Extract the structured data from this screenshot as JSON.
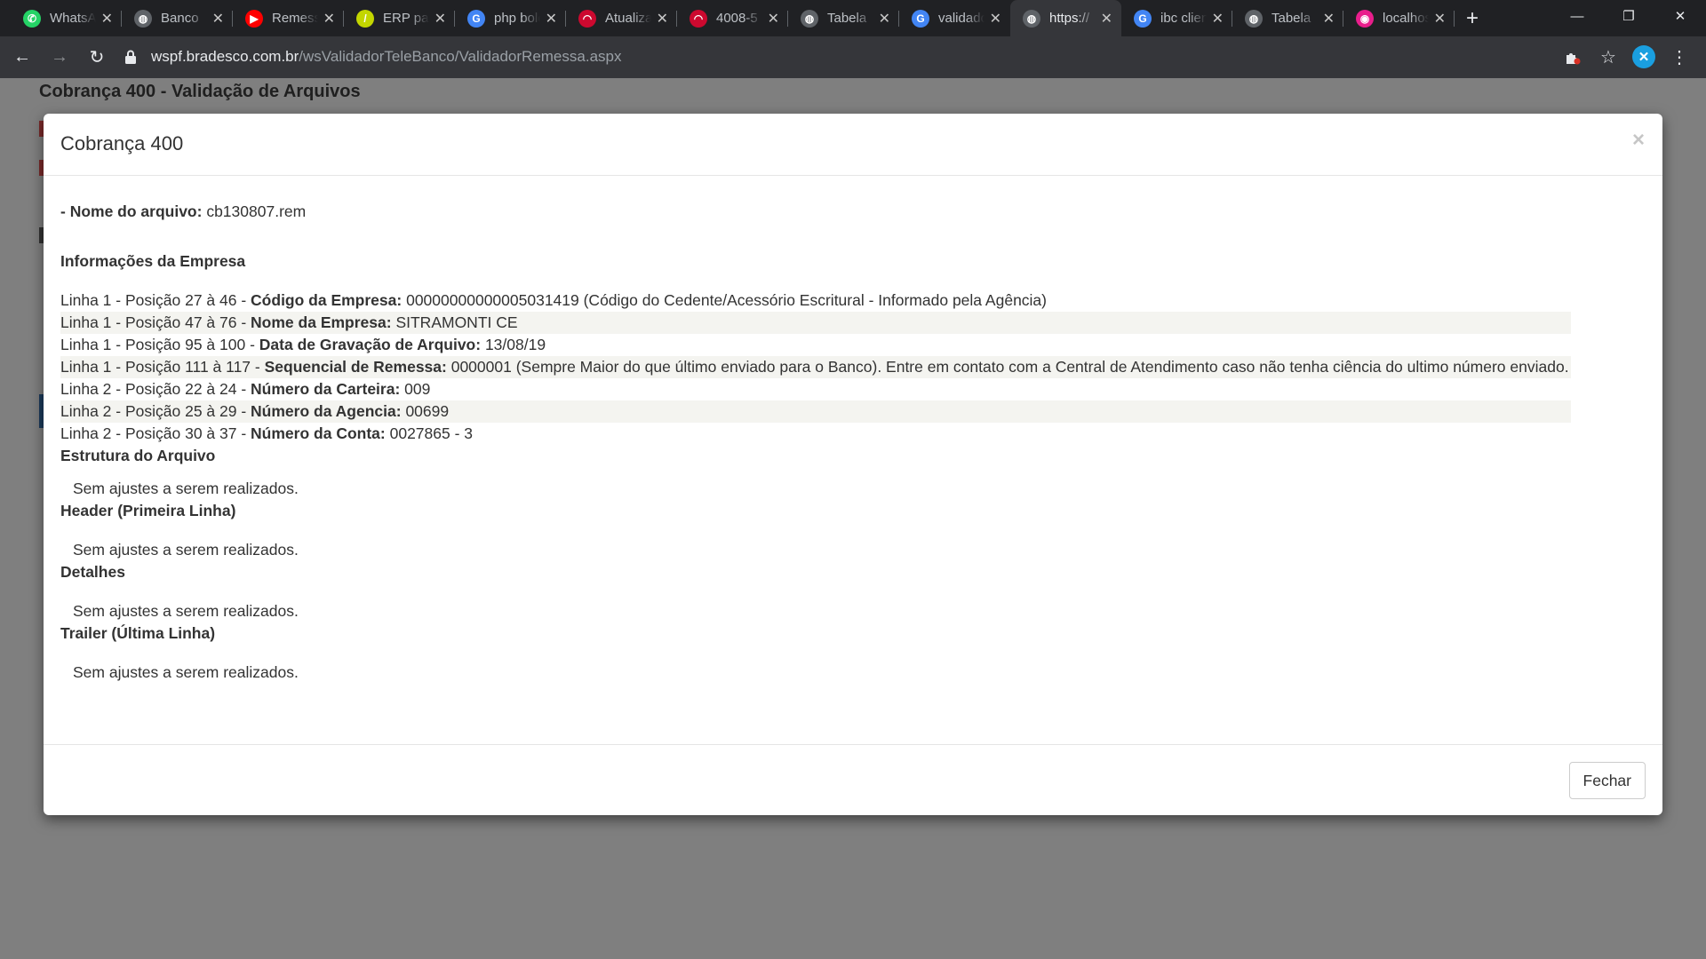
{
  "browser": {
    "tabs": [
      {
        "title": "WhatsApp",
        "icon": "whatsapp-icon",
        "color": "#25d366",
        "glyph": "✆"
      },
      {
        "title": "Banco",
        "icon": "globe-icon",
        "color": "#5f6368",
        "glyph": "◍"
      },
      {
        "title": "Remessa",
        "icon": "youtube-icon",
        "color": "#ff0000",
        "glyph": "▶"
      },
      {
        "title": "ERP para",
        "icon": "erp-icon",
        "color": "#c3d600",
        "glyph": "/"
      },
      {
        "title": "php boleto",
        "icon": "google-icon",
        "color": "#4285f4",
        "glyph": "G"
      },
      {
        "title": "Atualizar",
        "icon": "bradesco-icon",
        "color": "#cc092f",
        "glyph": "◠"
      },
      {
        "title": "4008-5",
        "icon": "bradesco-icon",
        "color": "#cc092f",
        "glyph": "◠"
      },
      {
        "title": "Tabela",
        "icon": "globe-icon",
        "color": "#5f6368",
        "glyph": "◍"
      },
      {
        "title": "validador",
        "icon": "google-icon",
        "color": "#4285f4",
        "glyph": "G"
      },
      {
        "title": "https://",
        "icon": "globe-icon",
        "color": "#5f6368",
        "glyph": "◍",
        "active": true
      },
      {
        "title": "ibc cliente",
        "icon": "google-icon",
        "color": "#4285f4",
        "glyph": "G"
      },
      {
        "title": "Tabela",
        "icon": "globe-icon",
        "color": "#5f6368",
        "glyph": "◍"
      },
      {
        "title": "localhost",
        "icon": "localhost-icon",
        "color": "#e91e8c",
        "glyph": "◉"
      }
    ],
    "new_tab": "+",
    "url_host": "wspf.bradesco.com.br",
    "url_path": "/wsValidadorTeleBanco/ValidadorRemessa.aspx"
  },
  "page": {
    "title": "Cobrança 400 - Validação de Arquivos"
  },
  "modal": {
    "title": "Cobrança 400",
    "close_glyph": "×",
    "file_label": "- Nome do arquivo:",
    "file_name": "cb130807.rem",
    "company_section": "Informações da Empresa",
    "rows": [
      {
        "prefix": "Linha 1 - Posição 27 à 46 -",
        "label": "Código da Empresa:",
        "value": "00000000000005031419 (Código do Cedente/Acessório Escritural - Informado pela Agência)"
      },
      {
        "prefix": "Linha 1 - Posição 47 à 76 -",
        "label": "Nome da Empresa:",
        "value": "SITRAMONTI CE"
      },
      {
        "prefix": "Linha 1 - Posição 95 à 100 -",
        "label": "Data de Gravação de Arquivo:",
        "value": "13/08/19"
      },
      {
        "prefix": "Linha 1 - Posição 111 à 117 -",
        "label": "Sequencial de Remessa:",
        "value": "0000001 (Sempre Maior do que último enviado para o Banco). Entre em contato com a Central de Atendimento caso não tenha ciência do ultimo número enviado."
      },
      {
        "prefix": "Linha 2 - Posição 22 à 24 -",
        "label": "Número da Carteira:",
        "value": "009"
      },
      {
        "prefix": "Linha 2 - Posição 25 à 29 -",
        "label": "Número da Agencia:",
        "value": "00699"
      },
      {
        "prefix": "Linha 2 - Posição 30 à 37 -",
        "label": "Número da Conta:",
        "value": "0027865 - 3"
      }
    ],
    "structure_section": "Estrutura do Arquivo",
    "structure_note": "Sem ajustes a serem realizados.",
    "header_section": "Header (Primeira Linha)",
    "header_note": "Sem ajustes a serem realizados.",
    "details_section": "Detalhes",
    "details_note": "Sem ajustes a serem realizados.",
    "trailer_section": "Trailer (Última Linha)",
    "trailer_note": "Sem ajustes a serem realizados.",
    "close_button": "Fechar"
  }
}
